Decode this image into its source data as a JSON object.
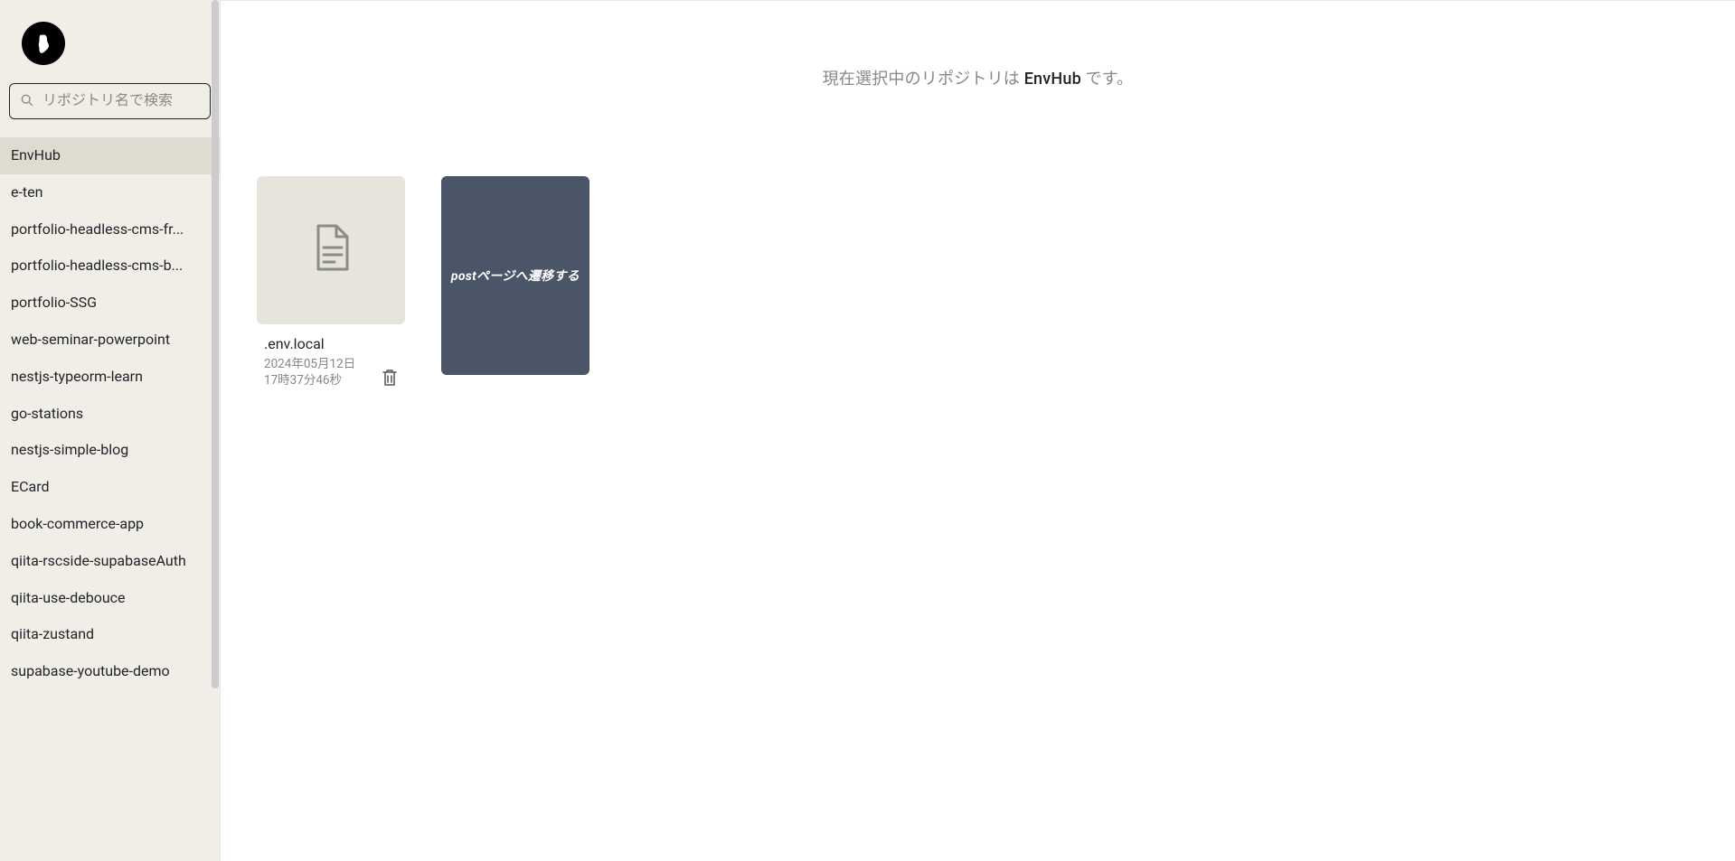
{
  "search": {
    "placeholder": "リポジトリ名で検索"
  },
  "header": {
    "prefix": "現在選択中のリポジトリは ",
    "repo_name": "EnvHub",
    "suffix": " です。"
  },
  "sidebar": {
    "selected_index": 0,
    "items": [
      {
        "label": "EnvHub"
      },
      {
        "label": "e-ten"
      },
      {
        "label": "portfolio-headless-cms-fr..."
      },
      {
        "label": "portfolio-headless-cms-b..."
      },
      {
        "label": "portfolio-SSG"
      },
      {
        "label": "web-seminar-powerpoint"
      },
      {
        "label": "nestjs-typeorm-learn"
      },
      {
        "label": "go-stations"
      },
      {
        "label": "nestjs-simple-blog"
      },
      {
        "label": "ECard"
      },
      {
        "label": "book-commerce-app"
      },
      {
        "label": "qiita-rscside-supabaseAuth"
      },
      {
        "label": "qiita-use-debouce"
      },
      {
        "label": "qiita-zustand"
      },
      {
        "label": "supabase-youtube-demo"
      }
    ]
  },
  "files": [
    {
      "name": ".env.local",
      "date_line1": "2024年05月12日",
      "date_line2": "17時37分46秒"
    }
  ],
  "nav_card": {
    "label": "postページへ遷移する"
  }
}
